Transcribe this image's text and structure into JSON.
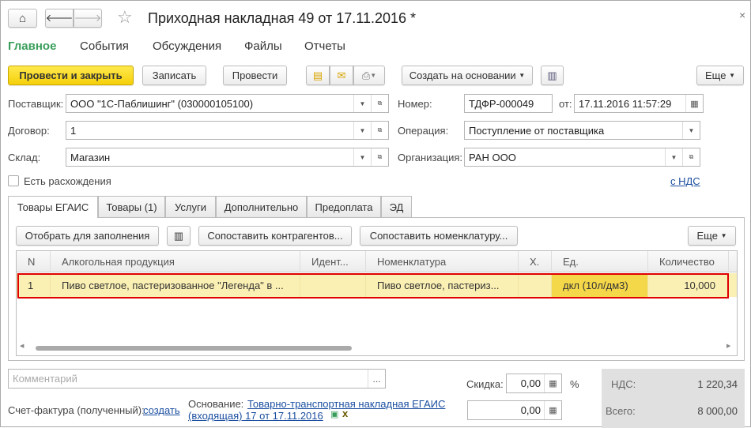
{
  "header": {
    "title": "Приходная накладная 49 от 17.11.2016 *",
    "close": "×",
    "home_icon": "home-icon",
    "back_icon": "arrow-left-icon",
    "forward_icon": "arrow-right-icon",
    "star_icon": "star-icon"
  },
  "nav": [
    "Главное",
    "События",
    "Обсуждения",
    "Файлы",
    "Отчеты"
  ],
  "toolbar": {
    "post_close": "Провести и закрыть",
    "save": "Записать",
    "post": "Провести",
    "create_based": "Создать на основании",
    "more": "Еще"
  },
  "fields": {
    "supplier_label": "Поставщик:",
    "supplier": "ООО \"1С-Паблишинг\" (030000105100)",
    "contract_label": "Договор:",
    "contract": "1",
    "warehouse_label": "Склад:",
    "warehouse": "Магазин",
    "number_label": "Номер:",
    "number": "ТДФР-000049",
    "date_label": "от:",
    "date": "17.11.2016 11:57:29",
    "operation_label": "Операция:",
    "operation": "Поступление от поставщика",
    "org_label": "Организация:",
    "org": "РАН ООО",
    "discrepancy": "Есть расхождения",
    "vat_link": "с НДС"
  },
  "tabs": [
    "Товары ЕГАИС",
    "Товары (1)",
    "Услуги",
    "Дополнительно",
    "Предоплата",
    "ЭД"
  ],
  "panel": {
    "select": "Отобрать для заполнения",
    "match_contractors": "Сопоставить контрагентов...",
    "match_items": "Сопоставить номенклатуру...",
    "more": "Еще"
  },
  "table": {
    "headers": [
      "N",
      "Алкогольная продукция",
      "Идент...",
      "Номенклатура",
      "Х.",
      "Ед.",
      "Количество"
    ],
    "rows": [
      [
        "1",
        "Пиво светлое, пастеризованное \"Легенда\" в ...",
        "",
        "Пиво светлое, пастериз...",
        "",
        "дкл (10л/дм3)",
        "10,000"
      ]
    ]
  },
  "footer": {
    "comment_placeholder": "Комментарий",
    "discount_label": "Скидка:",
    "discount": "0,00",
    "percent": "%",
    "amount": "0,00",
    "vat_label": "НДС:",
    "vat": "1 220,34",
    "total_label": "Всего:",
    "total": "8 000,00",
    "invoice_label": "Счет-фактура (полученный):",
    "invoice_link": "создать",
    "basis_label": "Основание:",
    "basis_link1": "Товарно-транспортная накладная ЕГАИС",
    "basis_link2": "(входящая) 17 от 17.11.2016",
    "remove": "x"
  },
  "colors": {
    "accent": "#f5cf0a",
    "nav_active": "#3a9e5b",
    "row_highlight": "#fbf0b4",
    "selected_cell": "#f5d84a",
    "outline": "#e00000"
  }
}
